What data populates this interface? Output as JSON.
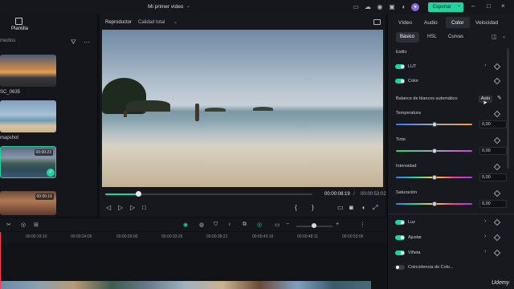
{
  "window": {
    "title": "Mi primer video",
    "export_label": "Exportar"
  },
  "left_panel": {
    "tab_label": "Plantilla",
    "search_placeholder": "medios",
    "media": [
      {
        "label": "SC_0635",
        "duration": ""
      },
      {
        "label": "mapshot",
        "duration": ""
      },
      {
        "label": "",
        "duration": "00:00:23"
      },
      {
        "label": "",
        "duration": "00:00:16"
      }
    ]
  },
  "player": {
    "label": "Reproductor",
    "quality": "Calidad total",
    "elapsed": "00:00:08:19",
    "separator": "/",
    "total": "00:00:53:02",
    "progress_fraction": 0.16
  },
  "right_panel": {
    "tabs": [
      "Vídeo",
      "Audio",
      "Color",
      "Velocidad"
    ],
    "active_tab": "Color",
    "subtabs": [
      "Básico",
      "HSL",
      "Curvas"
    ],
    "active_subtab": "Básico",
    "section_estilo": "Estilo",
    "lut_label": "LUT",
    "color_label": "Color",
    "white_balance_label": "Balance de blancos automático",
    "auto_label": "Auto",
    "sliders": [
      {
        "label": "Temperatura",
        "value": "0,00",
        "fraction": 0.5
      },
      {
        "label": "Tinte",
        "value": "0,00",
        "fraction": 0.5
      },
      {
        "label": "Intensidad",
        "value": "0,00",
        "fraction": 0.5
      },
      {
        "label": "Saturación",
        "value": "0,00",
        "fraction": 0.5
      }
    ],
    "luz_label": "Luz",
    "ajustar_label": "Ajustar",
    "vineta_label": "Viñeta",
    "coincidencia_label": "Coincidencia de Colo..."
  },
  "timeline": {
    "ticks": [
      "00:00:19:10",
      "00:00:24:05",
      "00:00:29:00",
      "00:00:33:25",
      "00:00:38:21",
      "00:00:43:16",
      "00:00:48:11",
      "00:00:53:06"
    ]
  },
  "watermark": "Udemy",
  "colors": {
    "accent": "#22d3a0",
    "playhead": "#ff3b5c"
  }
}
